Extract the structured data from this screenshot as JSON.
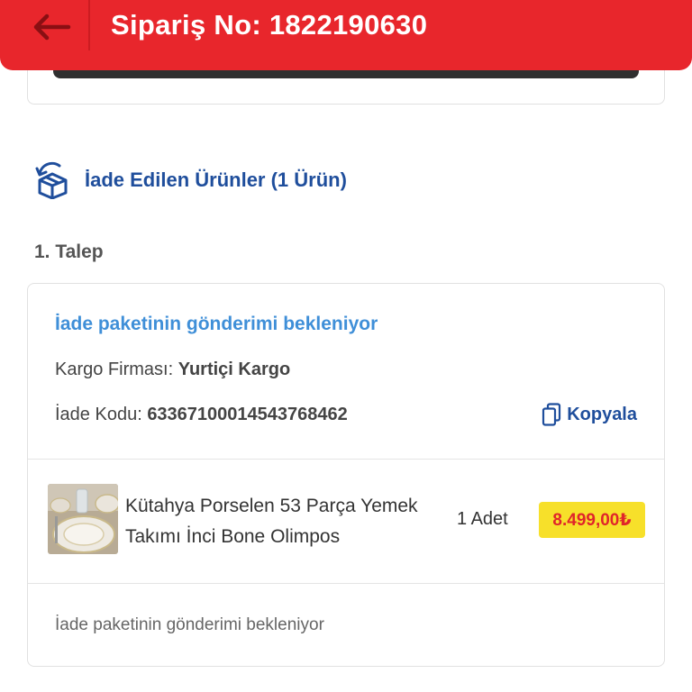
{
  "header": {
    "title": "Sipariş No: 1822190630",
    "back_icon": "arrow-left-icon",
    "color": "#e8262c"
  },
  "returned_products": {
    "label": "İade Edilen Ürünler (1 Ürün)",
    "icon": "return-box-icon",
    "color": "#1f4e9c"
  },
  "request": {
    "title": "1. Talep",
    "status_title": "İade paketinin gönderimi bekleniyor",
    "status_color": "#3f8fd8",
    "cargo_label": "Kargo Firması: ",
    "cargo_value": "Yurtiçi Kargo",
    "code_label": "İade Kodu: ",
    "code_value": "63367100014543768462",
    "copy_label": "Kopyala",
    "copy_icon": "copy-icon",
    "product": {
      "name": "Kütahya Porselen 53 Parça Yemek Takımı İnci Bone Olimpos",
      "image": "dinnerware-set-image",
      "quantity": "1 Adet",
      "price": "8.499,00₺",
      "price_bg": "#f7e02a",
      "price_color": "#e0252a"
    },
    "footer_status": "İade paketinin gönderimi bekleniyor"
  }
}
